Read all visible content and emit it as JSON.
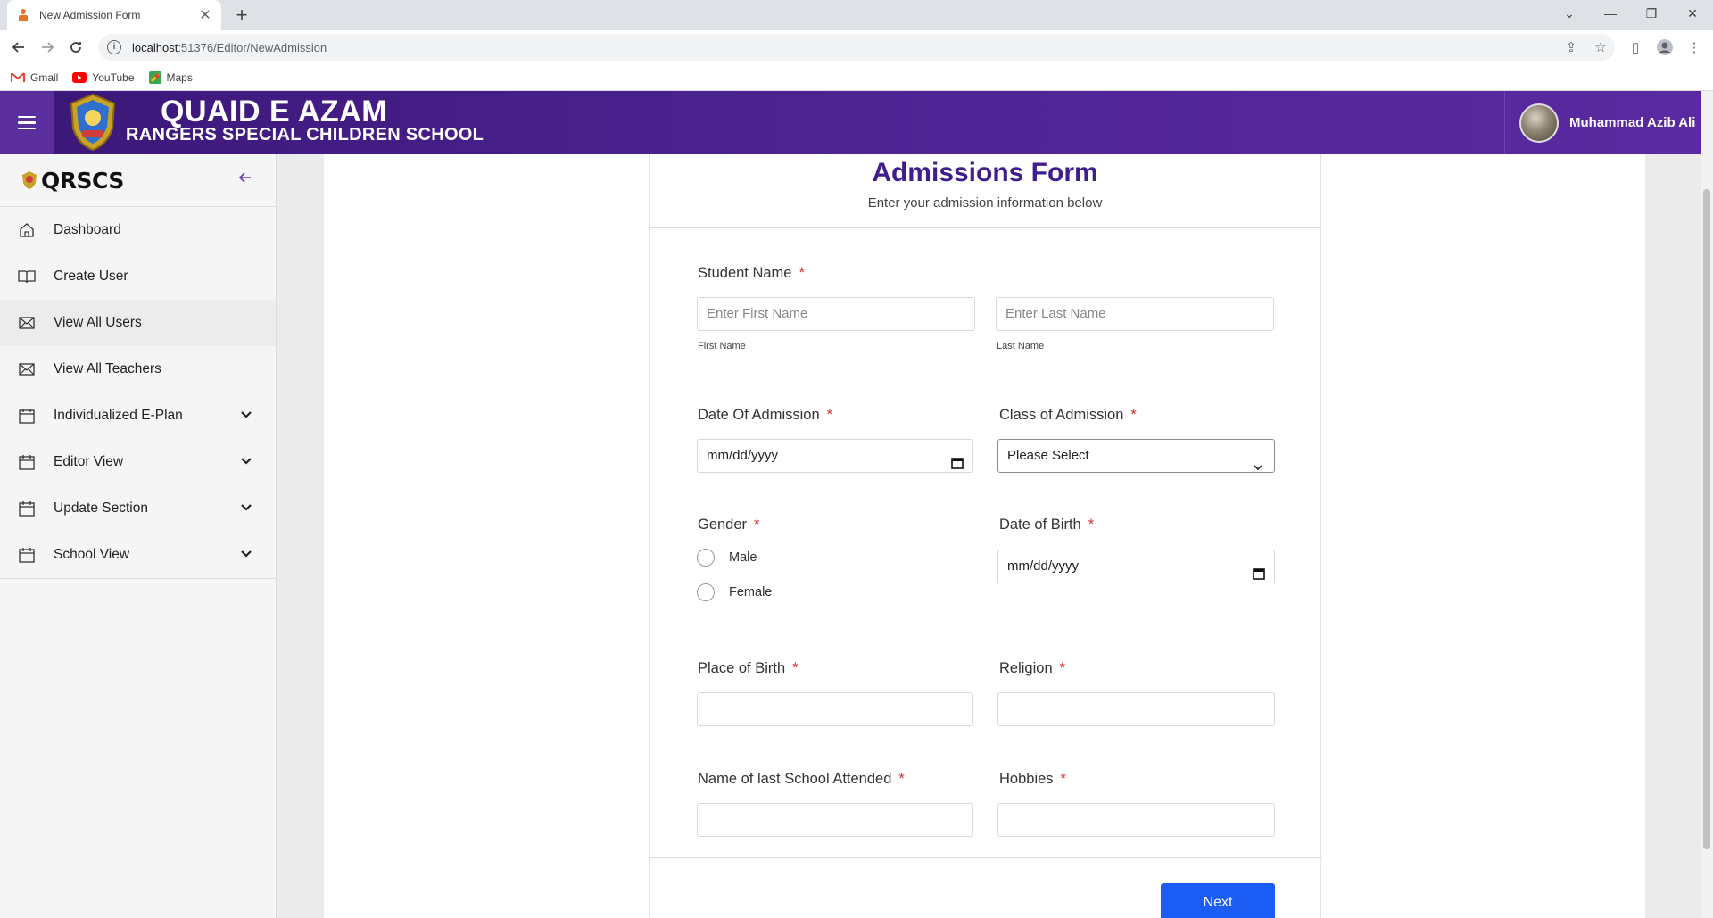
{
  "browser": {
    "tab_title": "New Admission Form",
    "url_host": "localhost",
    "url_path": ":51376/Editor/NewAdmission",
    "bookmarks": [
      {
        "label": "Gmail"
      },
      {
        "label": "YouTube"
      },
      {
        "label": "Maps"
      }
    ]
  },
  "header": {
    "brand_line1": "QUAID E AZAM",
    "brand_line2": "RANGERS SPECIAL CHILDREN SCHOOL",
    "user_name": "Muhammad Azib Ali",
    "colors": {
      "header_from": "#3b1778",
      "header_to": "#5a2aa0"
    }
  },
  "sidebar": {
    "title": "QRSCS",
    "items": [
      {
        "label": "Dashboard",
        "icon": "home-icon"
      },
      {
        "label": "Create User",
        "icon": "book-icon"
      },
      {
        "label": "View All Users",
        "icon": "envelope-icon",
        "active": true
      },
      {
        "label": "View All Teachers",
        "icon": "envelope-icon"
      },
      {
        "label": "Individualized E-Plan",
        "icon": "calendar-icon",
        "expandable": true
      },
      {
        "label": "Editor View",
        "icon": "calendar-icon",
        "expandable": true
      },
      {
        "label": "Update Section",
        "icon": "calendar-icon",
        "expandable": true
      },
      {
        "label": "School View",
        "icon": "calendar-icon",
        "expandable": true
      }
    ]
  },
  "form": {
    "title": "Admissions Form",
    "subtitle": "Enter your admission information below",
    "required_mark": "*",
    "student_name": {
      "label": "Student Name",
      "first_placeholder": "Enter First Name",
      "last_placeholder": "Enter Last Name",
      "first_sub": "First Name",
      "last_sub": "Last Name"
    },
    "date_of_admission": {
      "label": "Date Of Admission",
      "value": "mm/dd/yyyy"
    },
    "class_of_admission": {
      "label": "Class of Admission",
      "value": "Please Select"
    },
    "gender": {
      "label": "Gender",
      "options": [
        "Male",
        "Female"
      ]
    },
    "date_of_birth": {
      "label": "Date of Birth",
      "value": "mm/dd/yyyy"
    },
    "place_of_birth": {
      "label": "Place of Birth",
      "value": ""
    },
    "religion": {
      "label": "Religion",
      "value": ""
    },
    "last_school": {
      "label": "Name of last School Attended",
      "value": ""
    },
    "hobbies": {
      "label": "Hobbies",
      "value": ""
    },
    "next_label": "Next",
    "colors": {
      "title": "#3f1d8c",
      "required": "#d32f2f",
      "primary_button": "#1a5cf4"
    }
  }
}
